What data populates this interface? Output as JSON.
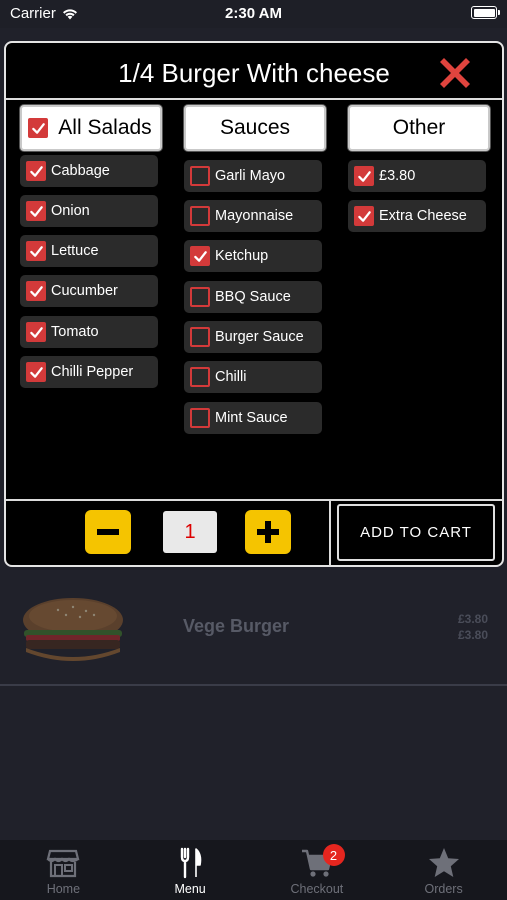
{
  "status_bar": {
    "carrier": "Carrier",
    "time": "2:30 AM"
  },
  "background": {
    "product_name": "Vege Burger",
    "prices": [
      "£3.80",
      "£3.80"
    ]
  },
  "modal": {
    "title": "1/4 Burger With cheese",
    "columns": [
      {
        "header": "All Salads",
        "header_checked": true,
        "items": [
          {
            "label": "Cabbage",
            "checked": true
          },
          {
            "label": "Onion",
            "checked": true
          },
          {
            "label": "Lettuce",
            "checked": true
          },
          {
            "label": "Cucumber",
            "checked": true
          },
          {
            "label": "Tomato",
            "checked": true
          },
          {
            "label": "Chilli Pepper",
            "checked": true
          }
        ]
      },
      {
        "header": "Sauces",
        "items": [
          {
            "label": "Garli Mayo",
            "checked": false
          },
          {
            "label": "Mayonnaise",
            "checked": false
          },
          {
            "label": "Ketchup",
            "checked": true
          },
          {
            "label": "BBQ Sauce",
            "checked": false
          },
          {
            "label": "Burger Sauce",
            "checked": false
          },
          {
            "label": "Chilli",
            "checked": false
          },
          {
            "label": "Mint Sauce",
            "checked": false
          }
        ]
      },
      {
        "header": "Other",
        "items": [
          {
            "label": "£3.80",
            "checked": true
          },
          {
            "label": "Extra Cheese",
            "checked": true
          }
        ]
      }
    ],
    "quantity": "1",
    "add_to_cart_label": "ADD TO CART"
  },
  "tab_bar": {
    "tabs": [
      {
        "label": "Home",
        "icon": "store-icon",
        "active": false
      },
      {
        "label": "Menu",
        "icon": "fork-knife-icon",
        "active": true
      },
      {
        "label": "Checkout",
        "icon": "cart-icon",
        "active": false,
        "badge": "2"
      },
      {
        "label": "Orders",
        "icon": "star-icon",
        "active": false
      }
    ]
  },
  "colors": {
    "accent_red": "#d33a3a",
    "accent_yellow": "#f5c400",
    "badge_red": "#e5261f"
  }
}
